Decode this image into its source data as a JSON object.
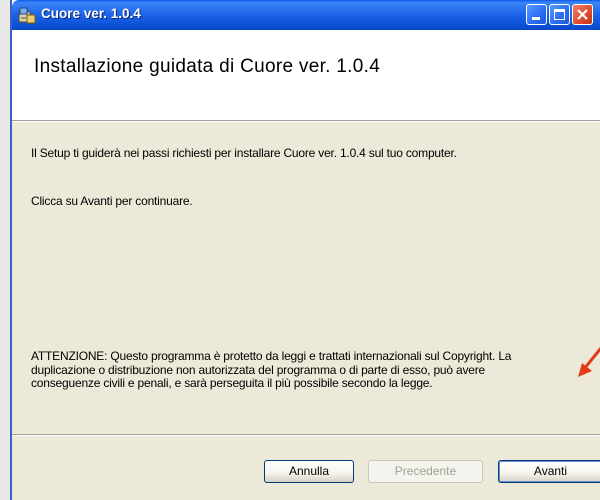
{
  "window": {
    "title": "Cuore ver. 1.0.4",
    "icon": "installer-icon",
    "controls": [
      "minimize-icon",
      "maximize-icon",
      "close-icon"
    ]
  },
  "header": {
    "title": "Installazione guidata di Cuore ver. 1.0.4"
  },
  "content": {
    "intro": "Il Setup ti guiderà nei passi richiesti per installare Cuore ver. 1.0.4 sul tuo computer.",
    "instruction": "Clicca su Avanti per continuare.",
    "warning_lines": [
      "ATTENZIONE: Questo programma è protetto da leggi e trattati internazionali sul Copyright. La",
      "duplicazione o distribuzione non autorizzata del programma o di parte di esso, può avere",
      "conseguenze civili e penali, e sarà perseguita il più possibile secondo la legge."
    ]
  },
  "buttons": {
    "cancel": "Annulla",
    "back": "Precedente",
    "next": "Avanti"
  },
  "colors": {
    "titlebar": "#0a58e8",
    "dialog_bg": "#ece9d8",
    "annotation_arrow": "#e53a1a"
  }
}
